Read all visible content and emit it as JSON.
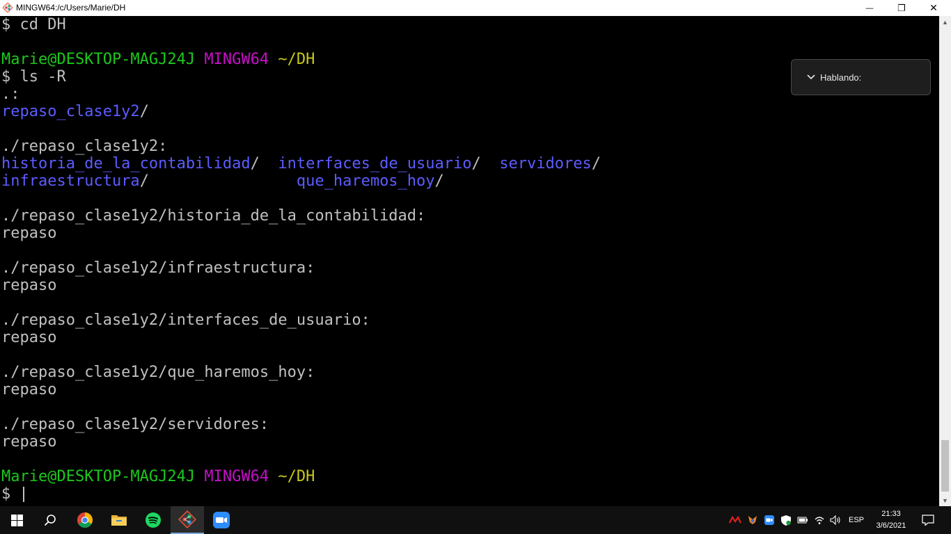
{
  "window": {
    "title": "MINGW64:/c/Users/Marie/DH",
    "minimize_glyph": "—",
    "maximize_glyph": "❐",
    "close_glyph": "✕"
  },
  "terminal": {
    "lines": [
      {
        "segments": [
          {
            "text": "$ cd DH",
            "color": "white"
          }
        ]
      },
      {
        "segments": []
      },
      {
        "segments": [
          {
            "text": "Marie@DESKTOP-MAGJ24J",
            "color": "green"
          },
          {
            "text": " ",
            "color": "white"
          },
          {
            "text": "MINGW64",
            "color": "magenta"
          },
          {
            "text": " ",
            "color": "white"
          },
          {
            "text": "~/DH",
            "color": "yellow"
          }
        ]
      },
      {
        "segments": [
          {
            "text": "$ ls -R",
            "color": "white"
          }
        ]
      },
      {
        "segments": [
          {
            "text": ".:",
            "color": "white"
          }
        ]
      },
      {
        "segments": [
          {
            "text": "repaso_clase1y2",
            "color": "blue"
          },
          {
            "text": "/",
            "color": "white"
          }
        ]
      },
      {
        "segments": []
      },
      {
        "segments": [
          {
            "text": "./repaso_clase1y2:",
            "color": "white"
          }
        ]
      },
      {
        "segments": [
          {
            "text": "historia_de_la_contabilidad",
            "color": "blue"
          },
          {
            "text": "/  ",
            "color": "white"
          },
          {
            "text": "interfaces_de_usuario",
            "color": "blue"
          },
          {
            "text": "/  ",
            "color": "white"
          },
          {
            "text": "servidores",
            "color": "blue"
          },
          {
            "text": "/",
            "color": "white"
          }
        ]
      },
      {
        "segments": [
          {
            "text": "infraestructura",
            "color": "blue"
          },
          {
            "text": "/                ",
            "color": "white"
          },
          {
            "text": "que_haremos_hoy",
            "color": "blue"
          },
          {
            "text": "/",
            "color": "white"
          }
        ]
      },
      {
        "segments": []
      },
      {
        "segments": [
          {
            "text": "./repaso_clase1y2/historia_de_la_contabilidad:",
            "color": "white"
          }
        ]
      },
      {
        "segments": [
          {
            "text": "repaso",
            "color": "white"
          }
        ]
      },
      {
        "segments": []
      },
      {
        "segments": [
          {
            "text": "./repaso_clase1y2/infraestructura:",
            "color": "white"
          }
        ]
      },
      {
        "segments": [
          {
            "text": "repaso",
            "color": "white"
          }
        ]
      },
      {
        "segments": []
      },
      {
        "segments": [
          {
            "text": "./repaso_clase1y2/interfaces_de_usuario:",
            "color": "white"
          }
        ]
      },
      {
        "segments": [
          {
            "text": "repaso",
            "color": "white"
          }
        ]
      },
      {
        "segments": []
      },
      {
        "segments": [
          {
            "text": "./repaso_clase1y2/que_haremos_hoy:",
            "color": "white"
          }
        ]
      },
      {
        "segments": [
          {
            "text": "repaso",
            "color": "white"
          }
        ]
      },
      {
        "segments": []
      },
      {
        "segments": [
          {
            "text": "./repaso_clase1y2/servidores:",
            "color": "white"
          }
        ]
      },
      {
        "segments": [
          {
            "text": "repaso",
            "color": "white"
          }
        ]
      },
      {
        "segments": []
      },
      {
        "segments": [
          {
            "text": "Marie@DESKTOP-MAGJ24J",
            "color": "green"
          },
          {
            "text": " ",
            "color": "white"
          },
          {
            "text": "MINGW64",
            "color": "magenta"
          },
          {
            "text": " ",
            "color": "white"
          },
          {
            "text": "~/DH",
            "color": "yellow"
          }
        ]
      },
      {
        "segments": [
          {
            "text": "$ ",
            "color": "white"
          }
        ],
        "cursor": true
      }
    ]
  },
  "speaking_overlay": {
    "label": "Hablando:"
  },
  "taskbar": {
    "apps": [
      {
        "name": "start-button",
        "icon": "windows-logo-icon",
        "interactable": true
      },
      {
        "name": "search-button",
        "icon": "search-icon",
        "interactable": true
      },
      {
        "name": "chrome-app",
        "icon": "chrome-icon",
        "interactable": true
      },
      {
        "name": "file-explorer-app",
        "icon": "folder-icon",
        "interactable": true
      },
      {
        "name": "spotify-app",
        "icon": "spotify-icon",
        "interactable": true
      },
      {
        "name": "git-bash-app",
        "icon": "git-bash-icon",
        "interactable": true,
        "active": true
      },
      {
        "name": "zoom-app",
        "icon": "zoom-icon",
        "interactable": true
      }
    ],
    "tray": {
      "language": "ESP",
      "time": "21:33",
      "date": "3/6/2021"
    }
  },
  "colors": {
    "green": "#1cc81c",
    "magenta": "#c80fc8",
    "yellow": "#c8c81a",
    "blue": "#5c5cff",
    "white": "#c0c0c0"
  }
}
